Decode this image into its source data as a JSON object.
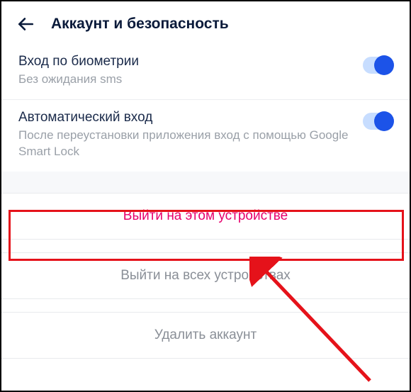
{
  "header": {
    "title": "Аккаунт и безопасность"
  },
  "biometrics": {
    "title": "Вход по биометрии",
    "desc": "Без ожидания sms",
    "enabled": true
  },
  "autologin": {
    "title": "Автоматический вход",
    "desc": "После переустановки приложения вход с помощью Google Smart Lock",
    "enabled": true
  },
  "actions": {
    "signout_this": "Выйти на этом устройстве",
    "signout_all": "Выйти на всех устройствах",
    "delete_account": "Удалить аккаунт"
  },
  "colors": {
    "accent": "#1c53e8",
    "danger": "#e6006d",
    "highlight": "#e5121a"
  }
}
